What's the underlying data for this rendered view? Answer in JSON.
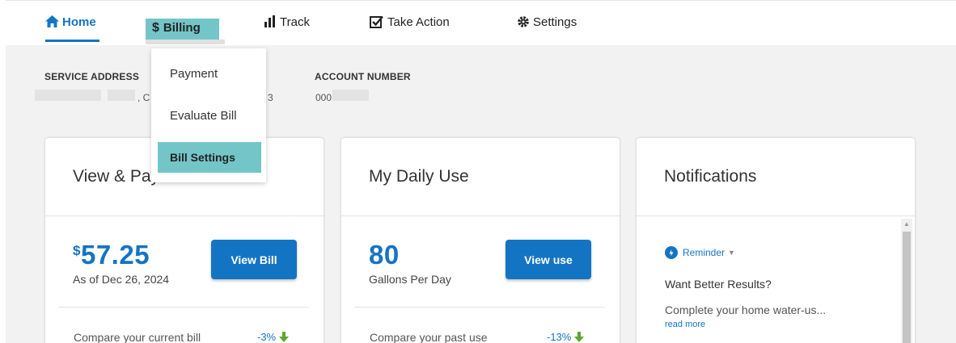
{
  "nav": {
    "home": "Home",
    "billing": "Billing",
    "track": "Track",
    "take_action": "Take Action",
    "settings": "Settings"
  },
  "billing_menu": {
    "items": [
      "Payment",
      "Evaluate Bill",
      "Bill Settings"
    ],
    "selected": "Bill Settings"
  },
  "account": {
    "service_address_label": "SERVICE ADDRESS",
    "service_address_value_partial": ", C",
    "service_address_value_end": "3",
    "account_number_label": "ACCOUNT NUMBER",
    "account_number_value_partial": "000"
  },
  "cards": {
    "bill": {
      "title": "View & Pay Bills",
      "currency": "$",
      "amount": "57.25",
      "as_of": "As of Dec 26, 2024",
      "button": "View Bill",
      "compare": "Compare your current bill",
      "change": "-3%"
    },
    "use": {
      "title": "My Daily Use",
      "amount": "80",
      "unit": "Gallons Per Day",
      "button": "View use",
      "compare": "Compare your past use",
      "change": "-13%"
    },
    "notifications": {
      "title": "Notifications",
      "tag": "Reminder",
      "heading": "Want Better Results?",
      "body": "Complete your home water-us...",
      "more": "read more"
    }
  },
  "colors": {
    "brand_blue": "#1474c4",
    "teal_highlight": "#74c5c7",
    "trend_down_green": "#5aa832"
  }
}
